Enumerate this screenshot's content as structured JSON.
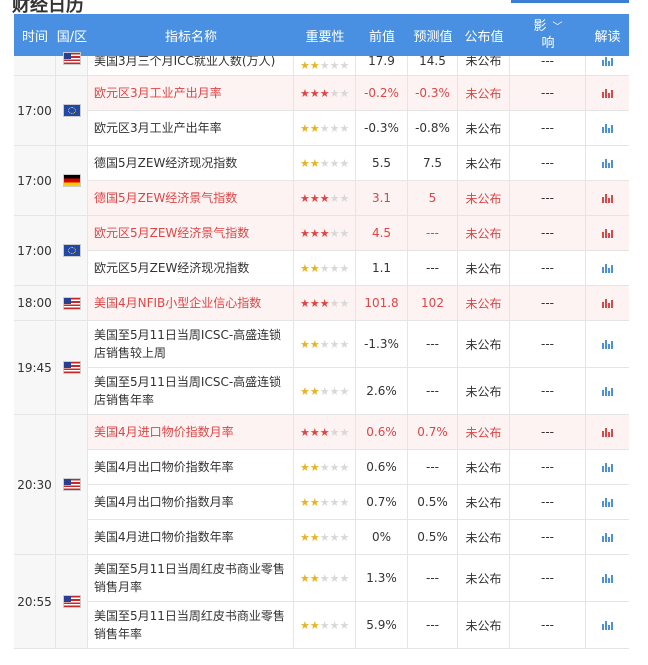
{
  "page_title": "财经日历",
  "header": {
    "time": "时间",
    "region": "国/区",
    "indicator": "指标名称",
    "importance": "重要性",
    "previous": "前值",
    "forecast": "预测值",
    "actual": "公布值",
    "impact_line1": "影",
    "impact_line2": "响",
    "read": "解读"
  },
  "groups": [
    {
      "time": "",
      "flag": "us",
      "rows": [
        {
          "name": "美国3月三个月ICC就业人数(万人)",
          "stars": 2,
          "prev": "17.9",
          "fore": "14.5",
          "act": "未公布",
          "impact": "---",
          "hl": false
        }
      ]
    },
    {
      "time": "17:00",
      "flag": "eu",
      "rows": [
        {
          "name": "欧元区3月工业产出月率",
          "stars": 3,
          "prev": "-0.2%",
          "fore": "-0.3%",
          "act": "未公布",
          "impact": "---",
          "hl": true
        },
        {
          "name": "欧元区3月工业产出年率",
          "stars": 2,
          "prev": "-0.3%",
          "fore": "-0.8%",
          "act": "未公布",
          "impact": "---",
          "hl": false
        }
      ]
    },
    {
      "time": "17:00",
      "flag": "de",
      "rows": [
        {
          "name": "德国5月ZEW经济现况指数",
          "stars": 2,
          "prev": "5.5",
          "fore": "7.5",
          "act": "未公布",
          "impact": "---",
          "hl": false
        },
        {
          "name": "德国5月ZEW经济景气指数",
          "stars": 3,
          "prev": "3.1",
          "fore": "5",
          "act": "未公布",
          "impact": "---",
          "hl": true
        }
      ]
    },
    {
      "time": "17:00",
      "flag": "eu",
      "rows": [
        {
          "name": "欧元区5月ZEW经济景气指数",
          "stars": 3,
          "prev": "4.5",
          "fore": "---",
          "act": "未公布",
          "impact": "---",
          "hl": true
        },
        {
          "name": "欧元区5月ZEW经济现况指数",
          "stars": 2,
          "prev": "1.1",
          "fore": "---",
          "act": "未公布",
          "impact": "---",
          "hl": false
        }
      ]
    },
    {
      "time": "18:00",
      "flag": "us",
      "rows": [
        {
          "name": "美国4月NFIB小型企业信心指数",
          "stars": 3,
          "prev": "101.8",
          "fore": "102",
          "act": "未公布",
          "impact": "---",
          "hl": true
        }
      ]
    },
    {
      "time": "19:45",
      "flag": "us",
      "rows": [
        {
          "name": "美国至5月11日当周ICSC-高盛连锁店销售较上周",
          "stars": 2,
          "prev": "-1.3%",
          "fore": "---",
          "act": "未公布",
          "impact": "---",
          "hl": false,
          "tall": true
        },
        {
          "name": "美国至5月11日当周ICSC-高盛连锁店销售年率",
          "stars": 2,
          "prev": "2.6%",
          "fore": "---",
          "act": "未公布",
          "impact": "---",
          "hl": false,
          "tall": true
        }
      ]
    },
    {
      "time": "20:30",
      "flag": "us",
      "rows": [
        {
          "name": "美国4月进口物价指数月率",
          "stars": 3,
          "prev": "0.6%",
          "fore": "0.7%",
          "act": "未公布",
          "impact": "---",
          "hl": true
        },
        {
          "name": "美国4月出口物价指数年率",
          "stars": 2,
          "prev": "0.6%",
          "fore": "---",
          "act": "未公布",
          "impact": "---",
          "hl": false
        },
        {
          "name": "美国4月出口物价指数月率",
          "stars": 2,
          "prev": "0.7%",
          "fore": "0.5%",
          "act": "未公布",
          "impact": "---",
          "hl": false
        },
        {
          "name": "美国4月进口物价指数年率",
          "stars": 2,
          "prev": "0%",
          "fore": "0.5%",
          "act": "未公布",
          "impact": "---",
          "hl": false
        }
      ]
    },
    {
      "time": "20:55",
      "flag": "us",
      "rows": [
        {
          "name": "美国至5月11日当周红皮书商业零售销售月率",
          "stars": 2,
          "prev": "1.3%",
          "fore": "---",
          "act": "未公布",
          "impact": "---",
          "hl": false,
          "tall": true
        },
        {
          "name": "美国至5月11日当周红皮书商业零售销售年率",
          "stars": 2,
          "prev": "5.9%",
          "fore": "---",
          "act": "未公布",
          "impact": "---",
          "hl": false,
          "tall": true
        }
      ]
    }
  ]
}
